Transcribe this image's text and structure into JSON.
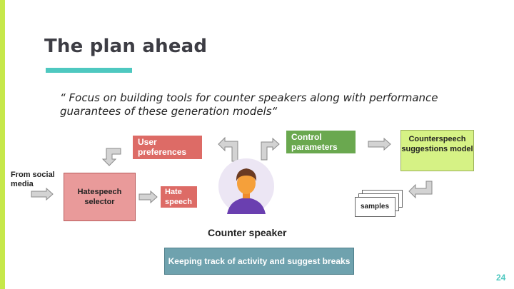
{
  "slide": {
    "title": "The plan ahead",
    "quote": "“ Focus on building tools for counter speakers along with performance guarantees of these generation models“",
    "page_number": "24"
  },
  "diagram": {
    "from_social_media": "From social media",
    "hatespeech_selector": "Hatespeech selector",
    "hate_speech": "Hate speech",
    "user_preferences": "User preferences",
    "control_parameters": "Control parameters",
    "counterspeech_model": "Counterspeech suggestions model",
    "samples": "samples",
    "counter_speaker": "Counter speaker",
    "tracking": "Keeping track of activity and suggest breaks"
  },
  "colors": {
    "accent_teal": "#4ec8c0",
    "strip_green": "#c6e84a",
    "red_box": "#dd6b66",
    "green_box": "#6aa84f",
    "lime_box": "#d6f285",
    "pink_box": "#e99a9a",
    "teal_box": "#6fa2ae"
  }
}
